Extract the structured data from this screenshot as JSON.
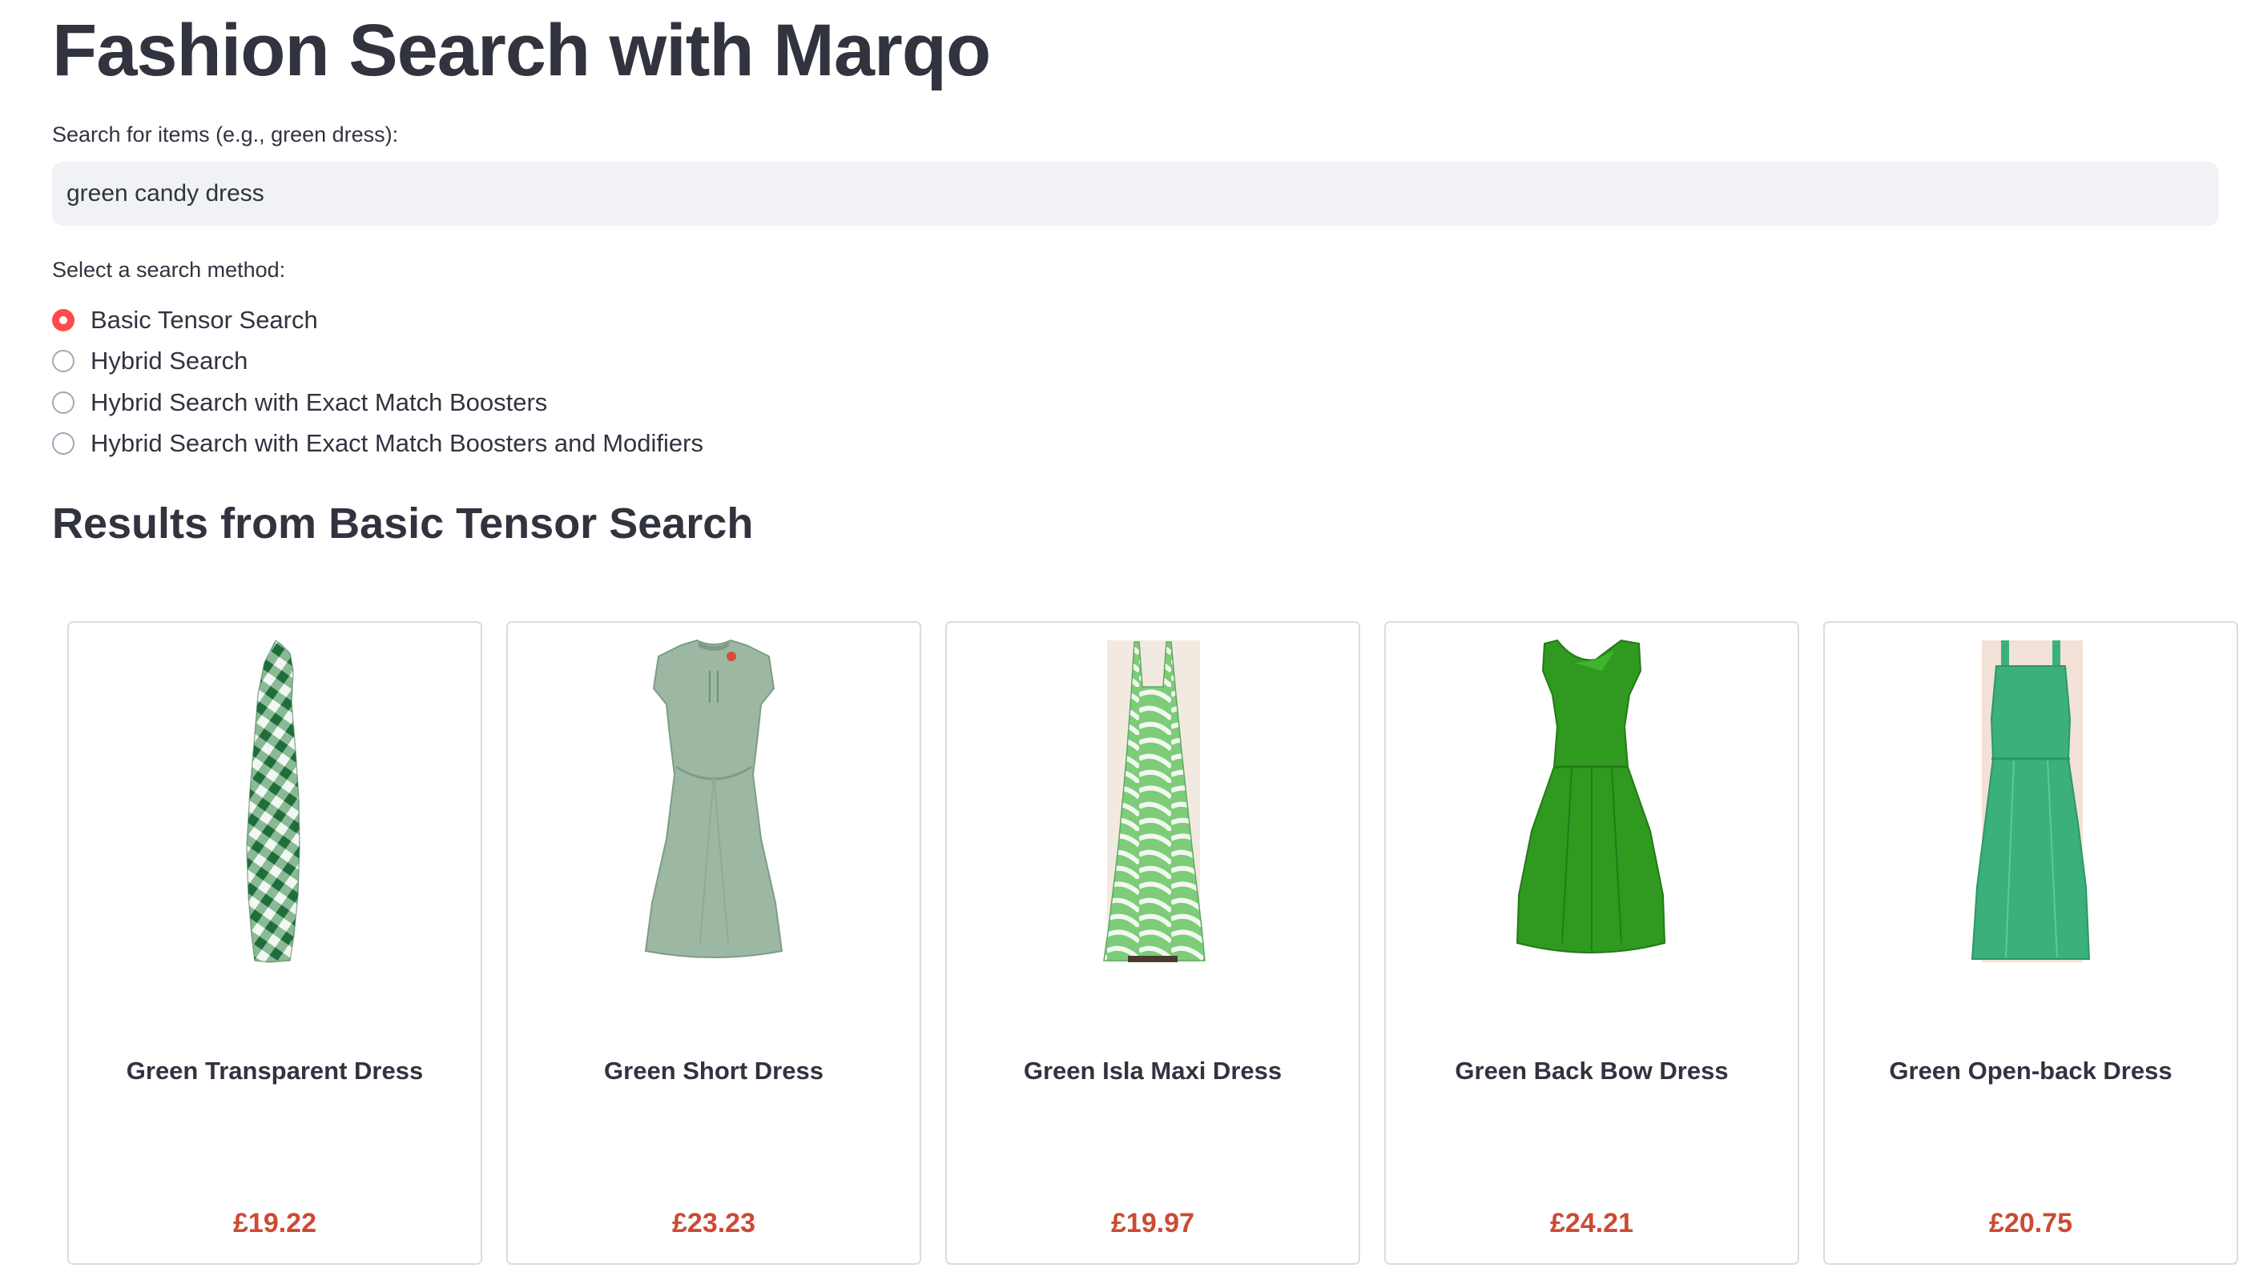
{
  "page": {
    "title": "Fashion Search with Marqo"
  },
  "search": {
    "label": "Search for items (e.g., green dress):",
    "value": "green candy dress"
  },
  "method": {
    "label": "Select a search method:",
    "options": [
      {
        "label": "Basic Tensor Search",
        "selected": true
      },
      {
        "label": "Hybrid Search",
        "selected": false
      },
      {
        "label": "Hybrid Search with Exact Match Boosters",
        "selected": false
      },
      {
        "label": "Hybrid Search with Exact Match Boosters and Modifiers",
        "selected": false
      }
    ]
  },
  "results": {
    "heading": "Results from Basic Tensor Search",
    "items": [
      {
        "name": "Green Transparent Dress",
        "price": "£19.22",
        "image": "green-gingham-maxi-dress"
      },
      {
        "name": "Green Short Dress",
        "price": "£23.23",
        "image": "sage-green-short-dress"
      },
      {
        "name": "Green Isla Maxi Dress",
        "price": "£19.97",
        "image": "green-palm-print-maxi-dress"
      },
      {
        "name": "Green Back Bow Dress",
        "price": "£24.21",
        "image": "bright-green-pleated-dress"
      },
      {
        "name": "Green Open-back Dress",
        "price": "£20.75",
        "image": "jade-green-open-back-dress"
      }
    ]
  },
  "colors": {
    "accent": "#ff4b4b",
    "price": "#cc4a33",
    "text": "#31333f",
    "input_bg": "#f0f2f6"
  }
}
